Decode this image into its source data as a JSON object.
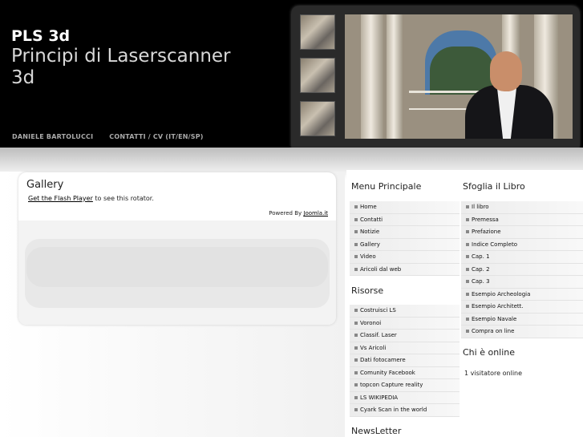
{
  "header": {
    "title": "PLS 3d",
    "subtitle": "Principi di Laserscanner 3d",
    "nav": [
      "DANIELE BARTOLUCCI",
      "CONTATTI / CV (IT/EN/SP)"
    ]
  },
  "gallery": {
    "title": "Gallery",
    "flash_link": "Get the Flash Player",
    "flash_text": " to see this rotator.",
    "powered_by": "Powered By ",
    "powered_link": "Joomla.it"
  },
  "menu_principale": {
    "title": "Menu Principale",
    "items": [
      "Home",
      "Contatti",
      "Notizie",
      "Gallery",
      "Video",
      "Aricoli dal web"
    ]
  },
  "risorse": {
    "title": "Risorse",
    "items": [
      "Costruisci LS",
      "Voronoi",
      "Classif. Laser",
      "Vs Aricoli",
      "Dati fotocamere",
      "Comunity Facebook",
      "topcon Capture reality",
      "LS WIKIPEDIA",
      "Cyark Scan in the world"
    ]
  },
  "sfoglia": {
    "title": "Sfoglia il Libro",
    "items": [
      "Il libro",
      "Premessa",
      "Prefazione",
      "Indice Completo",
      "Cap. 1",
      "Cap. 2",
      "Cap. 3",
      "Esempio Archeologia",
      "Esempio Architett.",
      "Esempio Navale",
      "Compra on line"
    ]
  },
  "online": {
    "title": "Chi è online",
    "text": "1 visitatore online"
  },
  "newsletter": {
    "title": "NewsLetter"
  }
}
